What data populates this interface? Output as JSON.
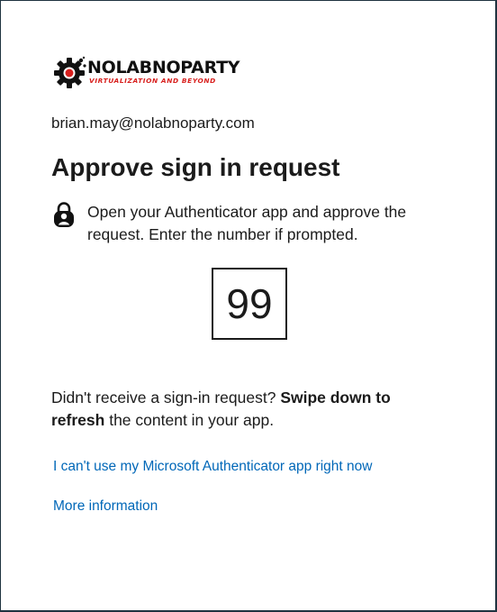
{
  "logo": {
    "name": "NOLABNOPARTY",
    "tagline": "VIRTUALIZATION AND BEYOND",
    "icon": "gear-icon"
  },
  "account": {
    "email": "brian.may@nolabnoparty.com"
  },
  "heading": "Approve sign in request",
  "instruction": {
    "icon": "authenticator-lock-icon",
    "text": "Open your Authenticator app and approve the request. Enter the number if prompted."
  },
  "number": "99",
  "refresh_note": {
    "prefix": "Didn't receive a sign-in request? ",
    "bold1": "Swipe down to",
    "space": " ",
    "bold2": "refresh",
    "suffix": " the content in your app."
  },
  "links": {
    "cant_use": "I can't use my Microsoft Authenticator app right now",
    "more_info": "More information"
  },
  "colors": {
    "link": "#0067b8",
    "brand_red": "#d8201e",
    "text": "#1b1b1b"
  }
}
